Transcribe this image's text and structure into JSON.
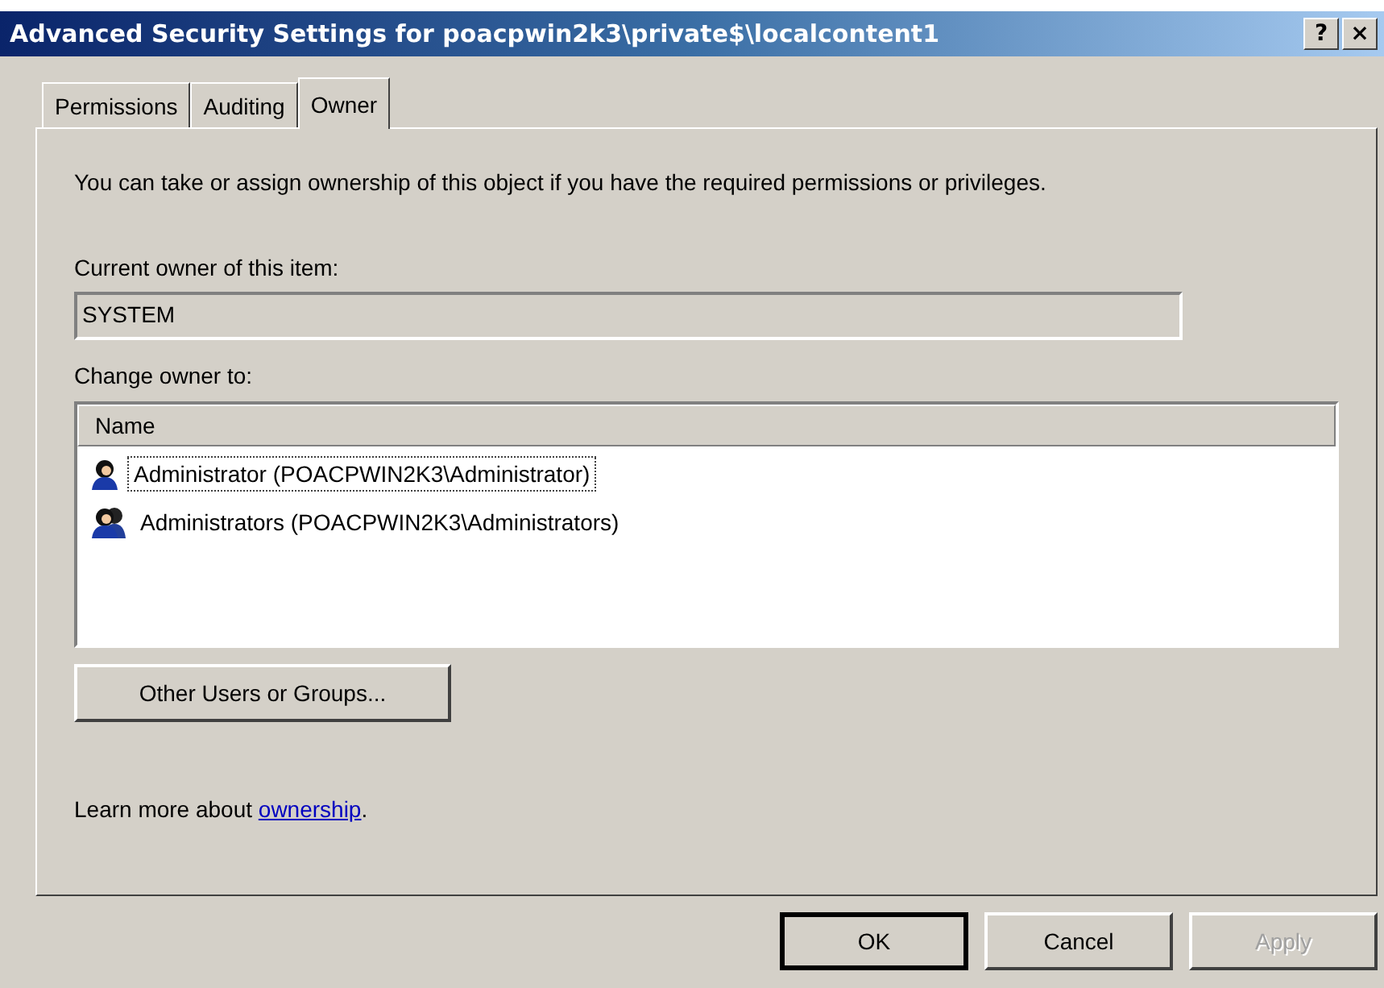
{
  "window": {
    "title": "Advanced Security Settings for poacpwin2k3\\private$\\localcontent1",
    "title_buttons": [
      "?",
      "×"
    ]
  },
  "tabs": [
    {
      "label": "Permissions",
      "selected": false
    },
    {
      "label": "Auditing",
      "selected": false
    },
    {
      "label": "Owner",
      "selected": true
    }
  ],
  "intro": "You can take or assign ownership of this object if you have the required permissions or privileges.",
  "current_owner": {
    "label": "Current owner of this item:",
    "value": "SYSTEM"
  },
  "change_owner": {
    "label": "Change owner to:",
    "columns": [
      "Name"
    ],
    "rows": [
      {
        "kind": "user",
        "name": "Administrator (POACPWIN2K3\\Administrator)",
        "focused": true
      },
      {
        "kind": "group",
        "name": "Administrators (POACPWIN2K3\\Administrators)",
        "focused": false
      }
    ]
  },
  "other_button": "Other Users or Groups...",
  "learn_more": {
    "text": "Learn more about ",
    "link": "ownership",
    "after": "."
  },
  "buttons": [
    {
      "label": "OK",
      "default": true,
      "disabled": false
    },
    {
      "label": "Cancel",
      "default": false,
      "disabled": false
    },
    {
      "label": "Apply",
      "default": false,
      "disabled": true
    }
  ]
}
